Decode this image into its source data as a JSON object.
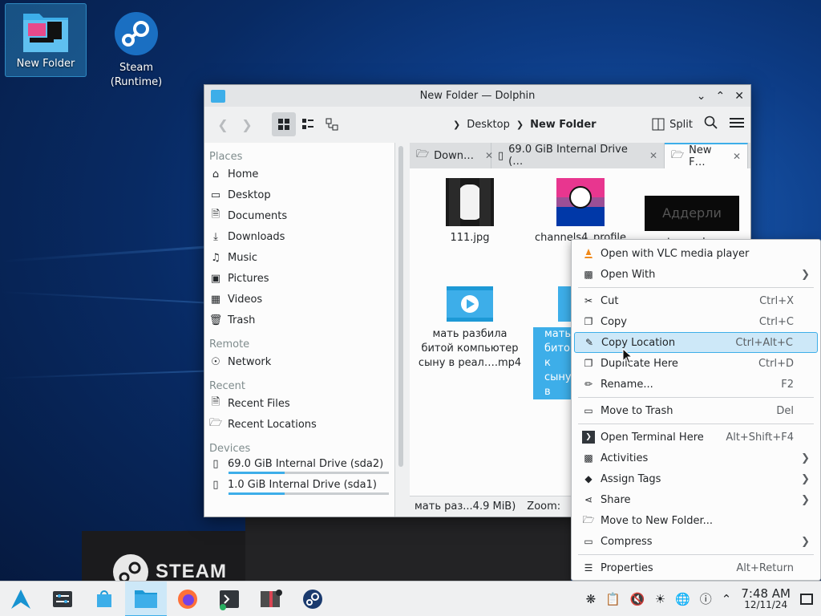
{
  "desktop": {
    "icons": [
      {
        "label": "New Folder"
      },
      {
        "label": "Steam\n(Runtime)",
        "line1": "Steam",
        "line2": "(Runtime)"
      }
    ],
    "steam_banner": "STEAM"
  },
  "window": {
    "title": "New Folder — Dolphin",
    "breadcrumb": [
      "Desktop",
      "New Folder"
    ],
    "split_label": "Split",
    "places": {
      "sections": [
        {
          "title": "Places",
          "items": [
            "Home",
            "Desktop",
            "Documents",
            "Downloads",
            "Music",
            "Pictures",
            "Videos",
            "Trash"
          ]
        },
        {
          "title": "Remote",
          "items": [
            "Network"
          ]
        },
        {
          "title": "Recent",
          "items": [
            "Recent Files",
            "Recent Locations"
          ]
        },
        {
          "title": "Devices",
          "items": [
            "69.0 GiB Internal Drive (sda2)",
            "1.0 GiB Internal Drive (sda1)"
          ]
        }
      ],
      "drive_usage": [
        0.35,
        0.35
      ]
    },
    "tabs": [
      "Down…",
      "69.0 GiB Internal Drive (…",
      "New F…"
    ],
    "files": [
      {
        "name": "111.jpg"
      },
      {
        "name": "channels4_profile"
      },
      {
        "name": "watermark.png",
        "thumb_text": "Аддерли"
      },
      {
        "name_lines": [
          "мать разбила",
          "битой компьютер",
          "сыну в реал….mp4"
        ]
      },
      {
        "name_lines": [
          "мать",
          "битой к",
          "сыну в"
        ]
      }
    ],
    "status": {
      "text": "мать раз...4.9 MiB)",
      "zoom_label": "Zoom:"
    }
  },
  "context_menu": {
    "items": [
      {
        "label": "Open with VLC media player",
        "icon": "vlc-icon"
      },
      {
        "label": "Open With",
        "submenu": true
      },
      {
        "sep": true
      },
      {
        "label": "Cut",
        "shortcut": "Ctrl+X"
      },
      {
        "label": "Copy",
        "shortcut": "Ctrl+C"
      },
      {
        "label": "Copy Location",
        "shortcut": "Ctrl+Alt+C",
        "highlighted": true
      },
      {
        "label": "Duplicate Here",
        "shortcut": "Ctrl+D"
      },
      {
        "label": "Rename...",
        "shortcut": "F2"
      },
      {
        "sep": true
      },
      {
        "label": "Move to Trash",
        "shortcut": "Del"
      },
      {
        "sep": true
      },
      {
        "label": "Open Terminal Here",
        "shortcut": "Alt+Shift+F4"
      },
      {
        "label": "Activities",
        "submenu": true
      },
      {
        "label": "Assign Tags",
        "submenu": true
      },
      {
        "label": "Share",
        "submenu": true
      },
      {
        "label": "Move to New Folder..."
      },
      {
        "label": "Compress",
        "submenu": true
      },
      {
        "sep": true
      },
      {
        "label": "Properties",
        "shortcut": "Alt+Return"
      }
    ]
  },
  "taskbar": {
    "clock_time": "7:48 AM",
    "clock_date": "12/11/24"
  },
  "colors": {
    "accent": "#3daee9",
    "highlight_bg": "#cde8f8"
  }
}
